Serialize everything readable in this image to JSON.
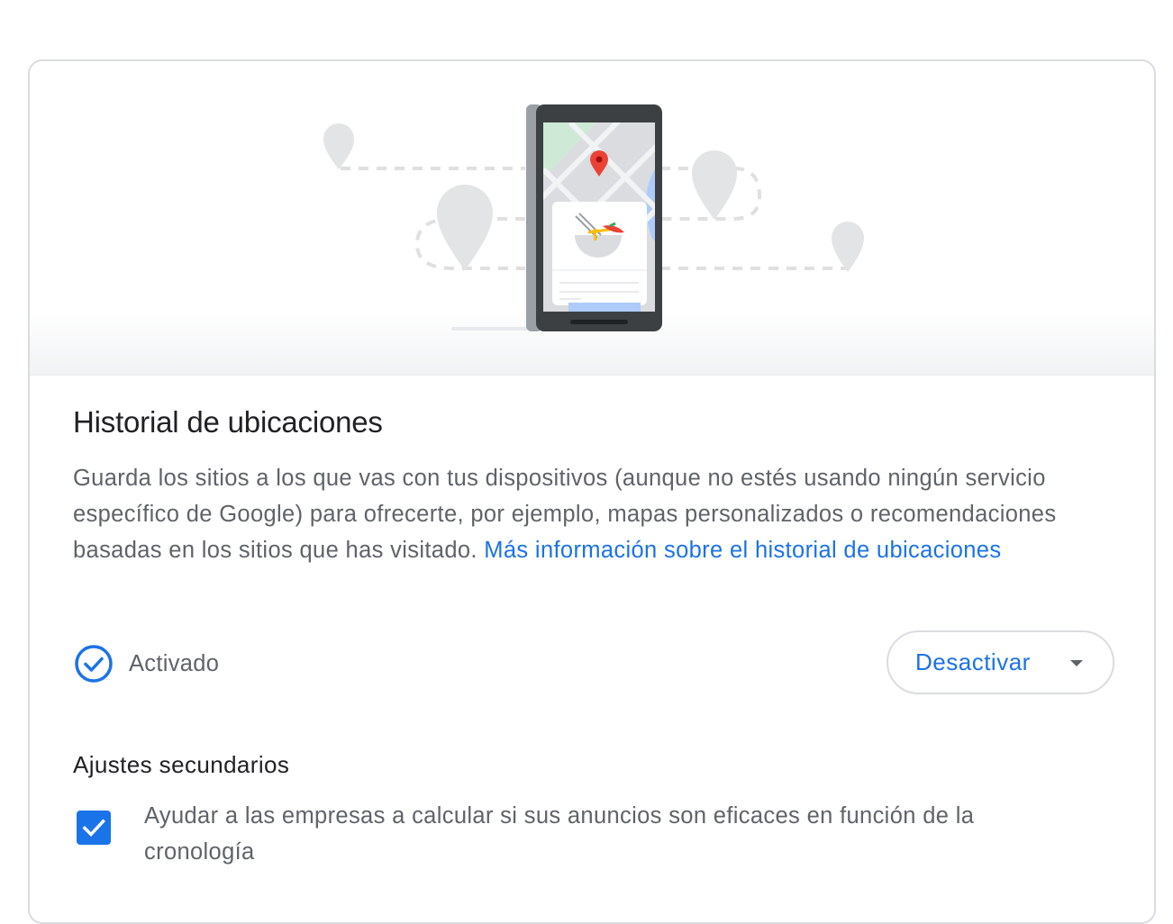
{
  "card": {
    "title": "Historial de ubicaciones",
    "description": "Guarda los sitios a los que vas con tus dispositivos (aunque no estés usando ningún servicio específico de Google) para ofrecerte, por ejemplo, mapas personalizados o recomendaciones basadas en los sitios que has visitado. ",
    "learn_more_link": "Más información sobre el historial de ubicaciones"
  },
  "status": {
    "icon": "check-circle-icon",
    "label": "Activado"
  },
  "action_button": {
    "label": "Desactivar",
    "icon": "caret-down-icon"
  },
  "secondary": {
    "title": "Ajustes secundarios",
    "items": [
      {
        "checked": true,
        "label": "Ayudar a las empresas a calcular si sus anuncios son eficaces en función de la cronología"
      }
    ]
  },
  "colors": {
    "accent": "#1a73e8",
    "border": "#dadce0",
    "text_primary": "#202124",
    "text_secondary": "#5f6368",
    "map_pin": "#ea4335"
  }
}
